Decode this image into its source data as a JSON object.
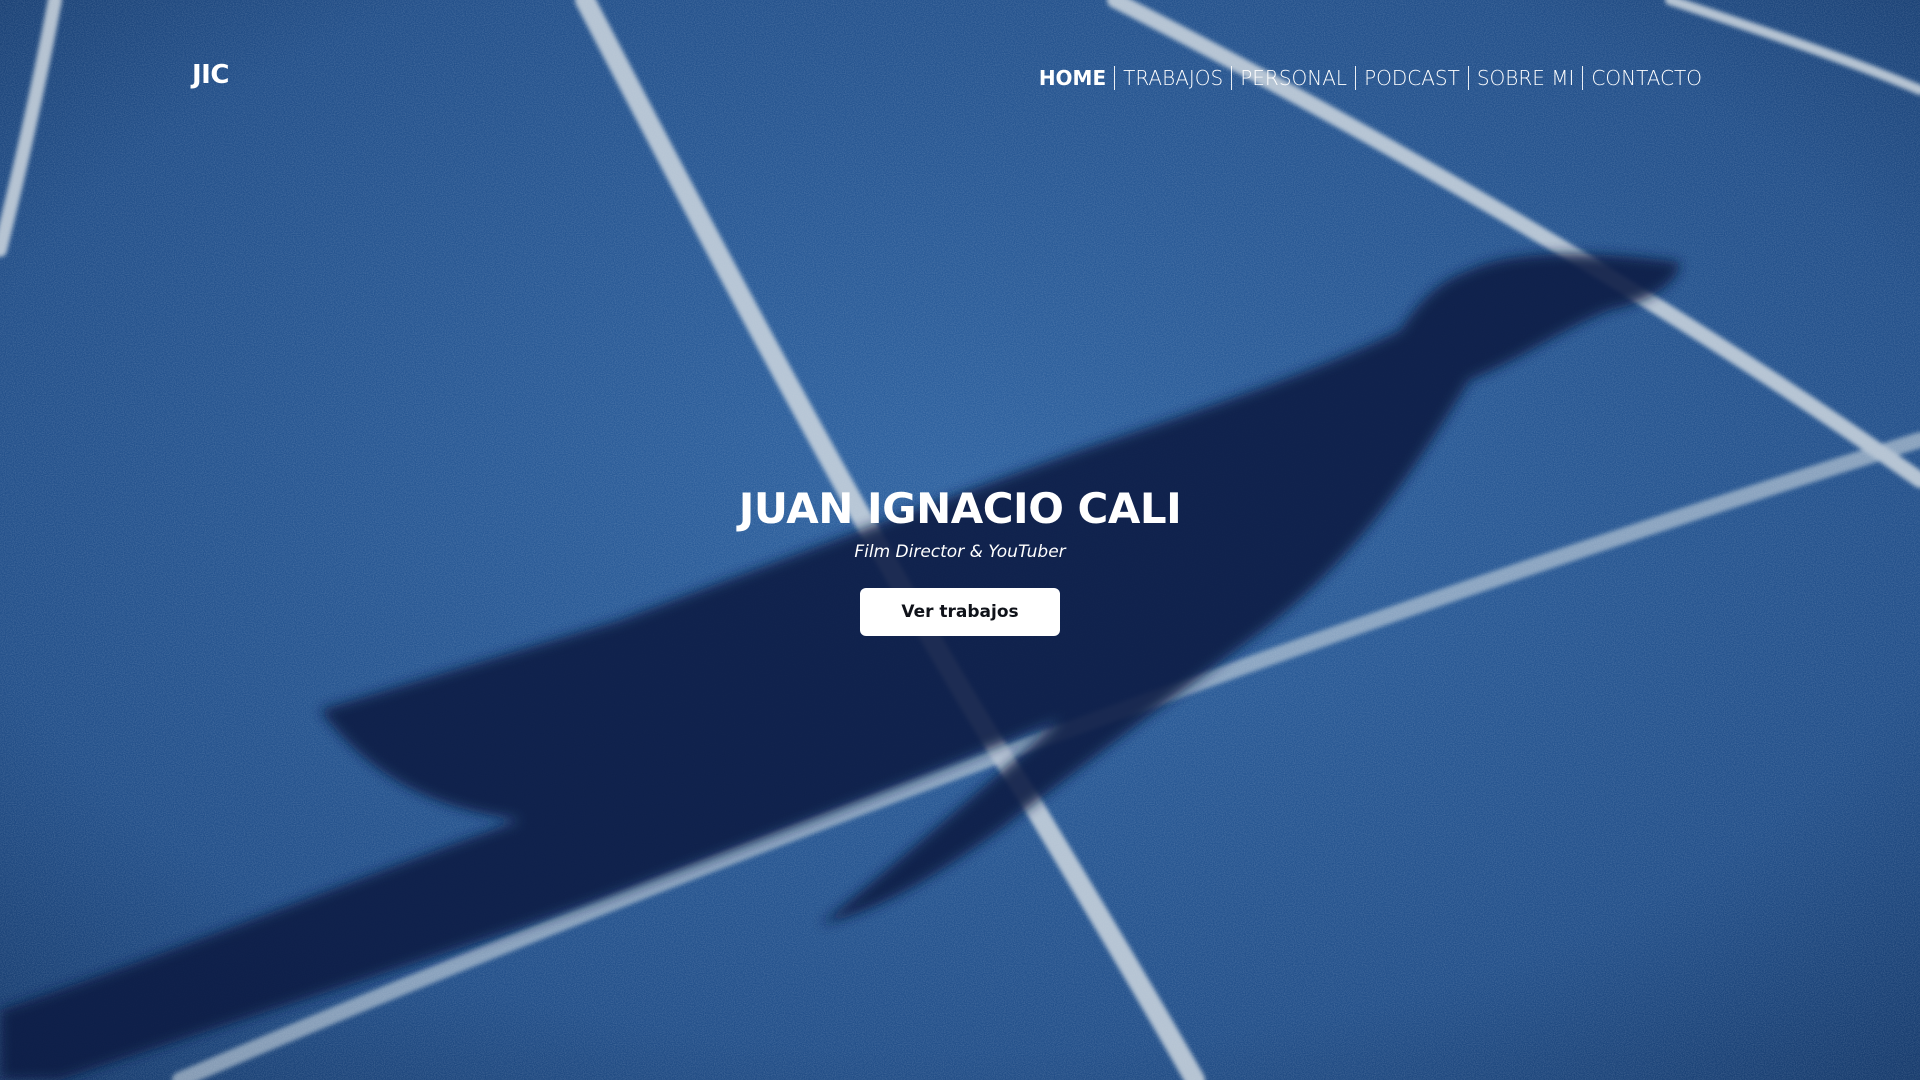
{
  "header": {
    "logo": "JIC",
    "nav": [
      {
        "label": "HOME",
        "active": true
      },
      {
        "label": "TRABAJOS",
        "active": false
      },
      {
        "label": "PERSONAL",
        "active": false
      },
      {
        "label": "PODCAST",
        "active": false
      },
      {
        "label": "SOBRE MI",
        "active": false
      },
      {
        "label": "CONTACTO",
        "active": false
      }
    ]
  },
  "hero": {
    "title": "JUAN IGNACIO CALI",
    "subtitle": "Film Director & YouTuber",
    "cta_label": "Ver trabajos"
  },
  "colors": {
    "track_blue": "#2a5a93",
    "shadow": "#0c1f45",
    "lane_line": "#c9d3dc",
    "text": "#ffffff",
    "button_bg": "#ffffff",
    "button_text": "#0f1219"
  }
}
